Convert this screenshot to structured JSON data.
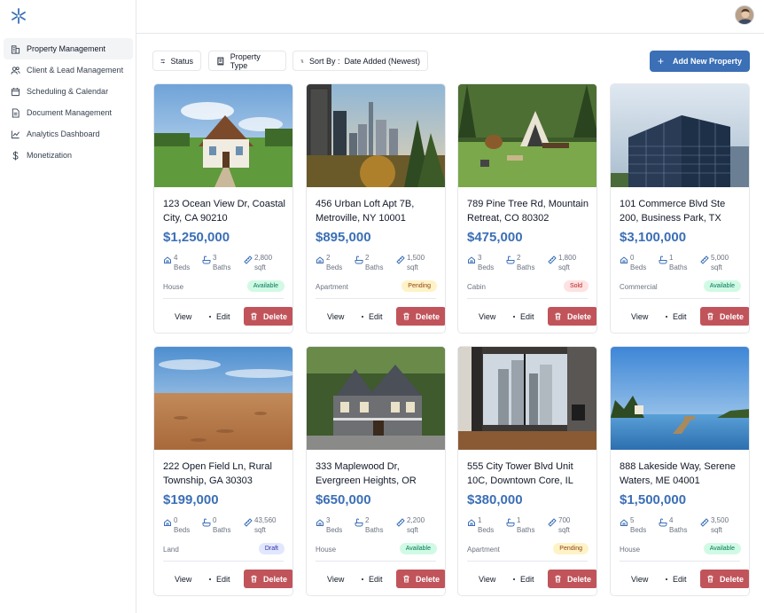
{
  "sidebar": {
    "items": [
      {
        "label": "Property Management",
        "icon": "building-icon",
        "active": true
      },
      {
        "label": "Client & Lead Management",
        "icon": "users-icon",
        "active": false
      },
      {
        "label": "Scheduling & Calendar",
        "icon": "calendar-icon",
        "active": false
      },
      {
        "label": "Document Management",
        "icon": "document-icon",
        "active": false
      },
      {
        "label": "Analytics Dashboard",
        "icon": "chart-icon",
        "active": false
      },
      {
        "label": "Monetization",
        "icon": "dollar-icon",
        "active": false
      }
    ]
  },
  "toolbar": {
    "status_label": "Status",
    "type_label": "Property Type",
    "sort_label": "Sort By :  Date Added (Newest)",
    "add_label": "Add New Property"
  },
  "colors": {
    "accent": "#3b6fb6",
    "delete": "#c0545a"
  },
  "properties": [
    {
      "address": "123 Ocean View Dr, Coastal City, CA 90210",
      "price": "$1,250,000",
      "beds": "4",
      "baths": "3",
      "sqft": "2,800",
      "type": "House",
      "status": "Available",
      "status_class": "available",
      "image": "house-photo"
    },
    {
      "address": "456 Urban Loft Apt 7B, Metroville, NY 10001",
      "price": "$895,000",
      "beds": "2",
      "baths": "2",
      "sqft": "1,500",
      "type": "Apartment",
      "status": "Pending",
      "status_class": "pending",
      "image": "city-skyline-photo"
    },
    {
      "address": "789 Pine Tree Rd, Mountain Retreat, CO 80302",
      "price": "$475,000",
      "beds": "3",
      "baths": "2",
      "sqft": "1,800",
      "type": "Cabin",
      "status": "Sold",
      "status_class": "sold",
      "image": "cabin-photo"
    },
    {
      "address": "101 Commerce Blvd Ste 200, Business Park, TX",
      "price": "$3,100,000",
      "beds": "0",
      "baths": "1",
      "sqft": "5,000",
      "type": "Commercial",
      "status": "Available",
      "status_class": "available",
      "image": "office-building-photo"
    },
    {
      "address": "222 Open Field Ln, Rural Township, GA 30303",
      "price": "$199,000",
      "beds": "0",
      "baths": "0",
      "sqft": "43,560",
      "type": "Land",
      "status": "Draft",
      "status_class": "draft",
      "image": "field-photo"
    },
    {
      "address": "333 Maplewood Dr, Evergreen Heights, OR",
      "price": "$650,000",
      "beds": "3",
      "baths": "2",
      "sqft": "2,200",
      "type": "House",
      "status": "Available",
      "status_class": "available",
      "image": "victorian-house-photo"
    },
    {
      "address": "555 City Tower Blvd Unit 10C, Downtown Core, IL",
      "price": "$380,000",
      "beds": "1",
      "baths": "1",
      "sqft": "700",
      "type": "Apartment",
      "status": "Pending",
      "status_class": "pending",
      "image": "apartment-interior-photo"
    },
    {
      "address": "888 Lakeside Way, Serene Waters, ME 04001",
      "price": "$1,500,000",
      "beds": "5",
      "baths": "4",
      "sqft": "3,500",
      "type": "House",
      "status": "Available",
      "status_class": "available",
      "image": "lake-dock-photo"
    }
  ],
  "card_labels": {
    "beds": "Beds",
    "baths": "Baths",
    "sqft": "sqft",
    "view": "View",
    "edit": "Edit",
    "delete": "Delete"
  }
}
